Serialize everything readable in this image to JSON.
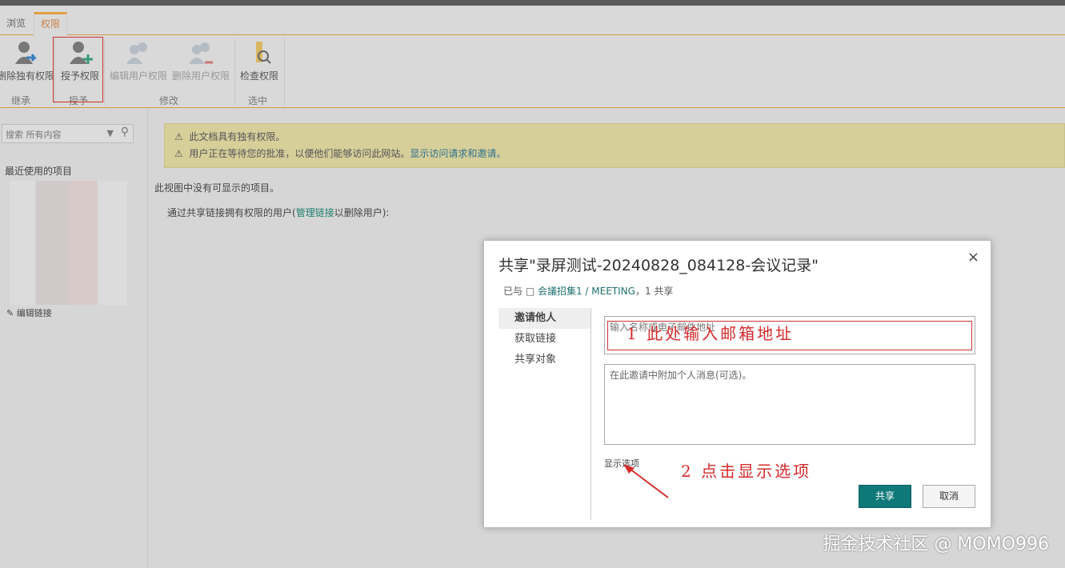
{
  "tabs": [
    "浏览",
    "权限"
  ],
  "ribbon": {
    "buttons": [
      "删除独有权限",
      "授予权限",
      "编辑用户权限",
      "删除用户权限",
      "检查权限"
    ],
    "groups": [
      "继承",
      "授予",
      "修改",
      "选中"
    ]
  },
  "left": {
    "search_placeholder": "搜索 所有内容",
    "recent": "最近使用的项目",
    "edit_links": "编辑链接"
  },
  "main": {
    "warn1": "此文档具有独有权限。",
    "warn2": "用户正在等待您的批准，以便他们能够访问此网站。",
    "warn2_link": "显示访问请求和邀请。",
    "empty": "此视图中没有可显示的项目。",
    "share_prefix": "通过共享链接拥有权限的用户(",
    "share_link": "管理链接",
    "share_suffix": "以删除用户):"
  },
  "dialog": {
    "title": "共享\"录屏测试-20240828_084128-会议记录\"",
    "shared_prefix": "已与 □ ",
    "shared_link": "会議招集1 / MEETING",
    "shared_suffix": "，1 共享",
    "close": "×",
    "side": [
      "邀请他人",
      "获取链接",
      "共享对象"
    ],
    "name_placeholder": "输入名称或电子邮件地址",
    "message_placeholder": "在此邀请中附加个人消息(可选)。",
    "show_options": "显示选项",
    "share": "共享",
    "cancel": "取消"
  },
  "annotations": {
    "a1": "1 此处输入邮箱地址",
    "a2": "2 点击显示选项"
  },
  "watermark": "掘金技术社区 @ MOMO996"
}
